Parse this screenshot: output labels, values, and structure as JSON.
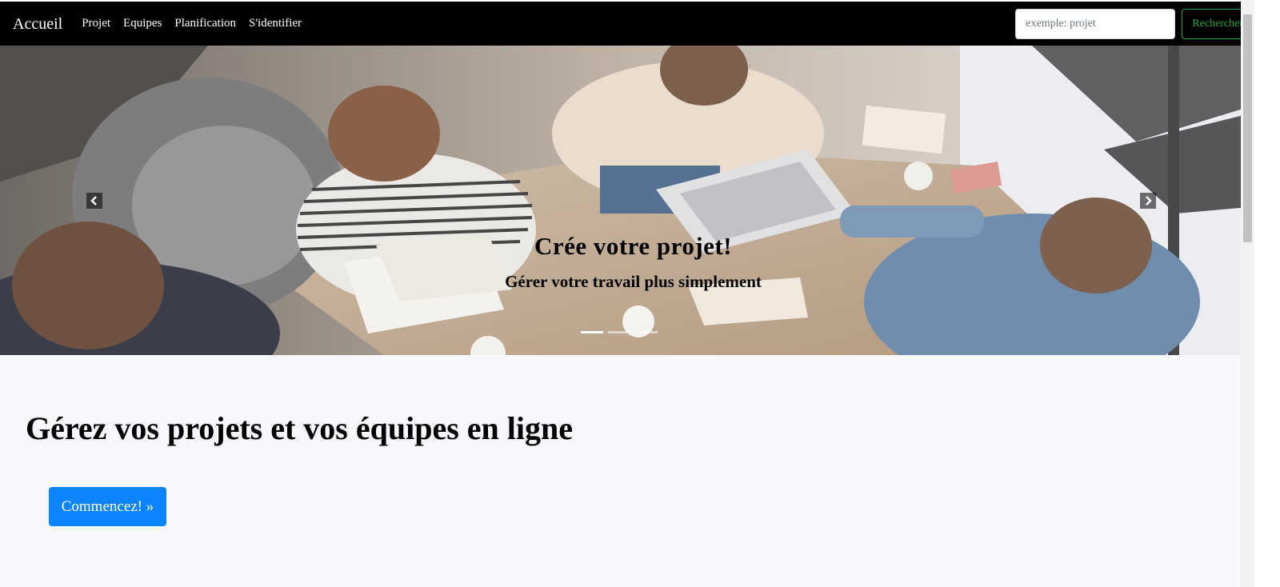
{
  "navbar": {
    "brand": "Accueil",
    "links": [
      "Projet",
      "Equipes",
      "Planification",
      "S'identifier"
    ],
    "search": {
      "placeholder": "exemple: projet",
      "value": "",
      "button_label": "Rechercher"
    }
  },
  "carousel": {
    "caption_title": "Crée votre projet!",
    "caption_subtitle": "Gérer votre travail plus simplement",
    "slide_count": 3,
    "active_slide": 1,
    "controls": {
      "prev_icon": "chevron-left-icon",
      "next_icon": "chevron-right-icon"
    }
  },
  "jumbotron": {
    "headline": "Gérez vos projets et vos équipes en ligne",
    "cta_label": "Commencez! »"
  },
  "colors": {
    "navbar_bg": "#000000",
    "search_button": "#28a745",
    "cta_button": "#0d84ff",
    "jumbotron_bg": "#f7f8fc"
  }
}
